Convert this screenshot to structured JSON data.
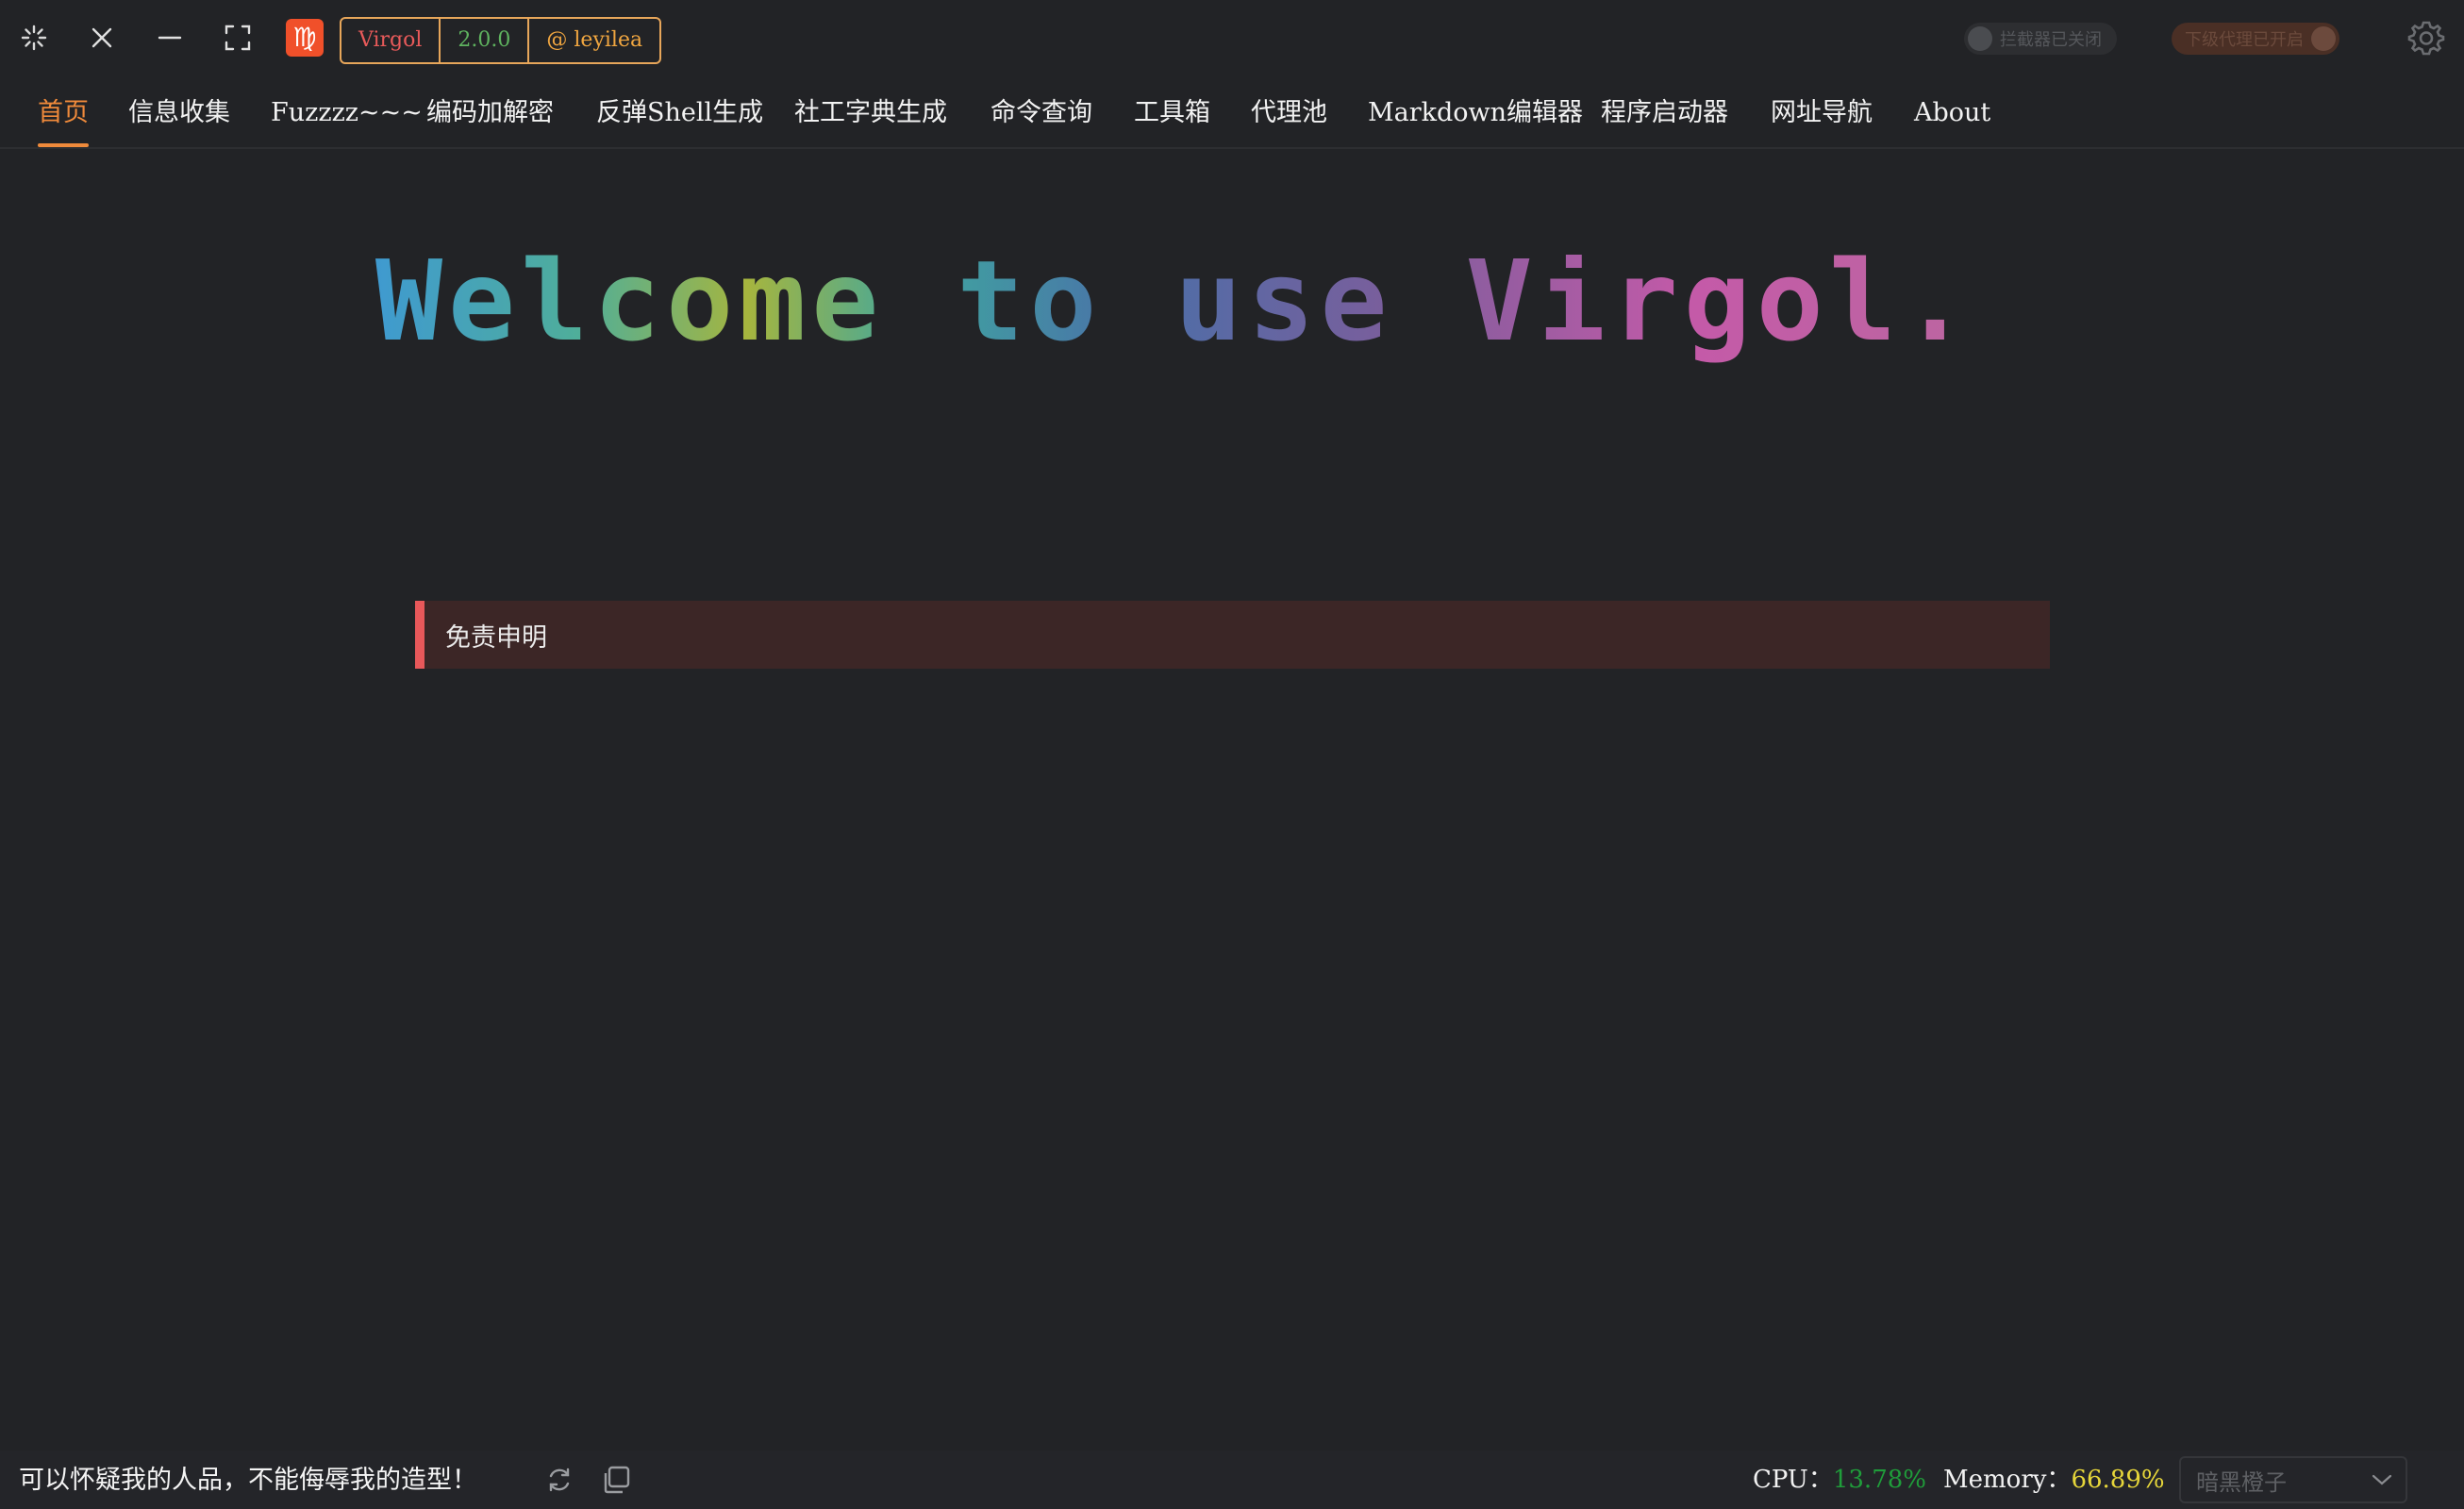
{
  "titlebar": {
    "app_logo_glyph": "♍",
    "badges": {
      "name": "Virgol",
      "version": "2.0.0",
      "author": "@ leyilea"
    },
    "interceptor_toggle": {
      "label": "拦截器已关闭",
      "state": "off"
    },
    "proxy_toggle": {
      "label": "下级代理已开启",
      "state": "on"
    },
    "icons": [
      "loading-icon",
      "close-icon",
      "minimize-icon",
      "fullscreen-icon",
      "gear-icon"
    ]
  },
  "nav": {
    "active": "首页",
    "items": [
      "首页",
      "信息收集",
      "Fuzzzz~~~",
      "编码加解密",
      "反弹Shell生成",
      "社工字典生成",
      "命令查询",
      "工具箱",
      "代理池",
      "Markdown编辑器",
      "程序启动器",
      "网址导航",
      "About"
    ]
  },
  "main": {
    "welcome_text": "Welcome to use Virgol.",
    "disclaimer_label": "免责申明"
  },
  "statusbar": {
    "slogan": "可以怀疑我的人品，不能侮辱我的造型！",
    "cpu_label": "CPU：",
    "cpu_value": "13.78%",
    "memory_label": "Memory：",
    "memory_value": "66.89%",
    "theme_selected": "暗黑橙子"
  },
  "colors": {
    "accent": "#ef8a3b",
    "background": "#222326",
    "cpu": "#1f9d3a",
    "memory": "#e6d63a",
    "disclaimer_bar": "#e8585a"
  }
}
